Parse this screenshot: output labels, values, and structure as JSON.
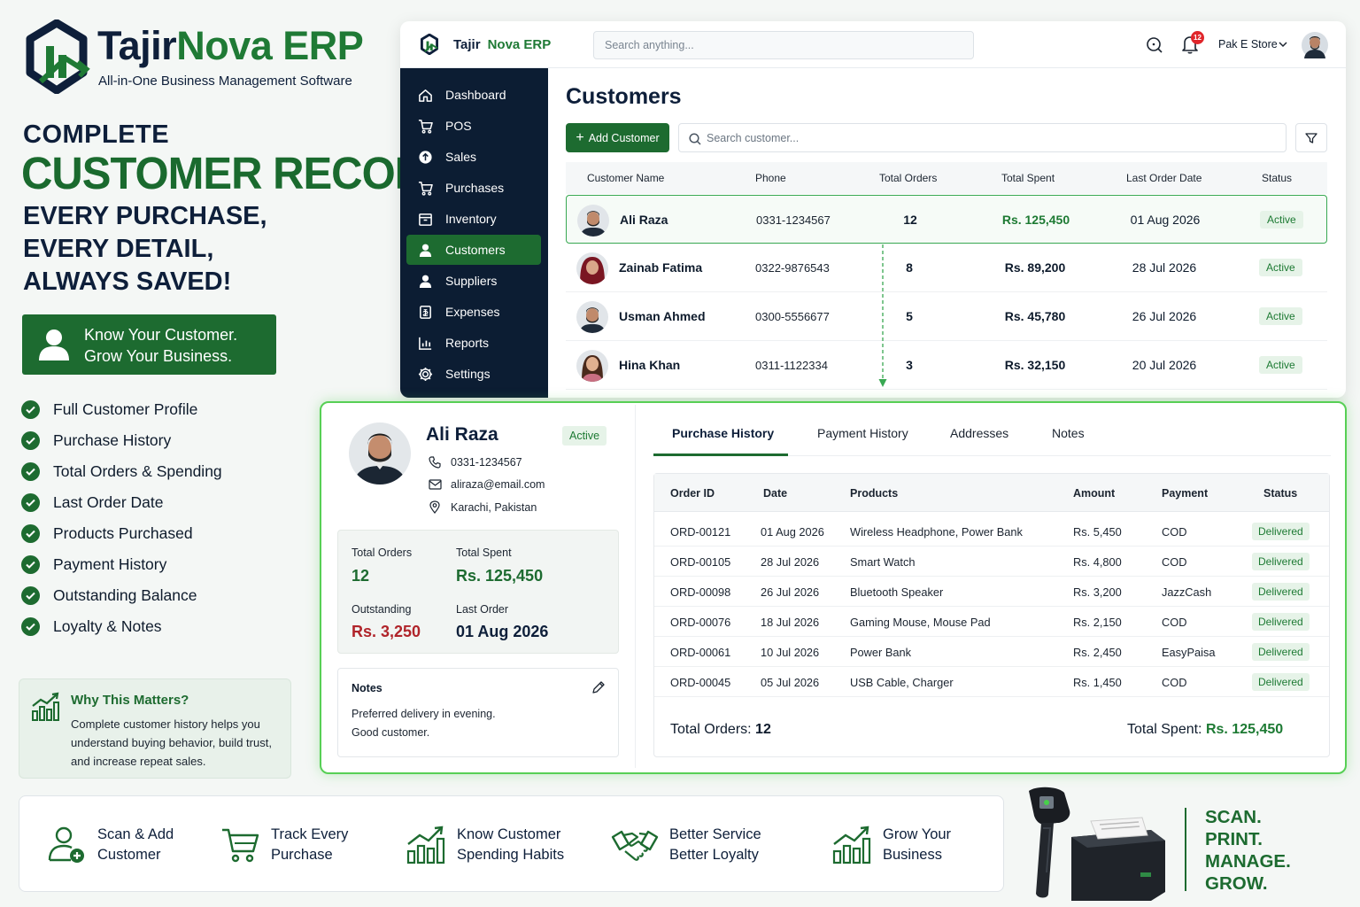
{
  "logo": {
    "name_part1": "Tajir",
    "name_part2": "Nova ERP",
    "tagline": "All-in-One Business Management Software"
  },
  "headline": {
    "line1": "COMPLETE",
    "line2": "CUSTOMER RECORD",
    "line3": "EVERY PURCHASE,",
    "line4": "EVERY DETAIL,",
    "line5": "ALWAYS SAVED!"
  },
  "banner": {
    "line1": "Know Your Customer.",
    "line2": "Grow Your Business."
  },
  "features": [
    "Full Customer Profile",
    "Purchase History",
    "Total Orders & Spending",
    "Last Order Date",
    "Products Purchased",
    "Payment History",
    "Outstanding Balance",
    "Loyalty & Notes"
  ],
  "why": {
    "title": "Why This Matters?",
    "text": "Complete customer history helps you understand buying behavior, build trust, and increase repeat sales."
  },
  "app": {
    "brand_part1": "Tajir",
    "brand_part2": "Nova ERP",
    "search_placeholder": "Search anything...",
    "notification_count": "12",
    "store_name": "Pak E Store",
    "sidebar": [
      {
        "label": "Dashboard",
        "icon": "home-icon"
      },
      {
        "label": "POS",
        "icon": "cart-icon"
      },
      {
        "label": "Sales",
        "icon": "sales-icon"
      },
      {
        "label": "Purchases",
        "icon": "cart-icon"
      },
      {
        "label": "Inventory",
        "icon": "inventory-icon"
      },
      {
        "label": "Customers",
        "icon": "user-icon",
        "active": true
      },
      {
        "label": "Suppliers",
        "icon": "user-icon"
      },
      {
        "label": "Expenses",
        "icon": "receipt-icon"
      },
      {
        "label": "Reports",
        "icon": "chart-icon"
      },
      {
        "label": "Settings",
        "icon": "gear-icon"
      }
    ],
    "page_title": "Customers",
    "add_button": "Add Customer",
    "customer_search_placeholder": "Search customer...",
    "columns": [
      "Customer Name",
      "Phone",
      "Total Orders",
      "Total Spent",
      "Last Order Date",
      "Status"
    ],
    "customers": [
      {
        "name": "Ali Raza",
        "phone": "0331-1234567",
        "orders": "12",
        "spent": "Rs. 125,450",
        "last": "01 Aug 2026",
        "status": "Active"
      },
      {
        "name": "Zainab Fatima",
        "phone": "0322-9876543",
        "orders": "8",
        "spent": "Rs. 89,200",
        "last": "28 Jul 2026",
        "status": "Active"
      },
      {
        "name": "Usman Ahmed",
        "phone": "0300-5556677",
        "orders": "5",
        "spent": "Rs. 45,780",
        "last": "26 Jul 2026",
        "status": "Active"
      },
      {
        "name": "Hina Khan",
        "phone": "0311-1122334",
        "orders": "3",
        "spent": "Rs. 32,150",
        "last": "20 Jul 2026",
        "status": "Active"
      }
    ]
  },
  "profile": {
    "name": "Ali Raza",
    "status": "Active",
    "phone": "0331-1234567",
    "email": "aliraza@email.com",
    "location": "Karachi, Pakistan",
    "stats": {
      "orders_label": "Total Orders",
      "orders": "12",
      "spent_label": "Total Spent",
      "spent": "Rs. 125,450",
      "outstanding_label": "Outstanding",
      "outstanding": "Rs. 3,250",
      "last_label": "Last Order",
      "last": "01 Aug 2026"
    },
    "notes_title": "Notes",
    "notes_line1": "Preferred delivery in evening.",
    "notes_line2": "Good customer."
  },
  "tabs": [
    "Purchase History",
    "Payment History",
    "Addresses",
    "Notes"
  ],
  "orders": {
    "columns": [
      "Order ID",
      "Date",
      "Products",
      "Amount",
      "Payment",
      "Status"
    ],
    "rows": [
      {
        "id": "ORD-00121",
        "date": "01 Aug 2026",
        "products": "Wireless Headphone, Power Bank",
        "amount": "Rs. 5,450",
        "payment": "COD",
        "status": "Delivered"
      },
      {
        "id": "ORD-00105",
        "date": "28 Jul 2026",
        "products": "Smart Watch",
        "amount": "Rs. 4,800",
        "payment": "COD",
        "status": "Delivered"
      },
      {
        "id": "ORD-00098",
        "date": "26 Jul 2026",
        "products": "Bluetooth Speaker",
        "amount": "Rs. 3,200",
        "payment": "JazzCash",
        "status": "Delivered"
      },
      {
        "id": "ORD-00076",
        "date": "18 Jul 2026",
        "products": "Gaming Mouse, Mouse Pad",
        "amount": "Rs. 2,150",
        "payment": "COD",
        "status": "Delivered"
      },
      {
        "id": "ORD-00061",
        "date": "10 Jul 2026",
        "products": "Power Bank",
        "amount": "Rs. 2,450",
        "payment": "EasyPaisa",
        "status": "Delivered"
      },
      {
        "id": "ORD-00045",
        "date": "05 Jul 2026",
        "products": "USB Cable, Charger",
        "amount": "Rs. 1,450",
        "payment": "COD",
        "status": "Delivered"
      }
    ],
    "footer_orders_label": "Total Orders:",
    "footer_orders": "12",
    "footer_spent_label": "Total Spent:",
    "footer_spent": "Rs. 125,450"
  },
  "bottom": [
    {
      "line1": "Scan & Add",
      "line2": "Customer",
      "icon": "add-user-icon"
    },
    {
      "line1": "Track Every",
      "line2": "Purchase",
      "icon": "cart-icon"
    },
    {
      "line1": "Know Customer",
      "line2": "Spending Habits",
      "icon": "growth-chart-icon"
    },
    {
      "line1": "Better Service",
      "line2": "Better Loyalty",
      "icon": "handshake-icon"
    },
    {
      "line1": "Grow Your",
      "line2": "Business",
      "icon": "growth-chart-icon"
    }
  ],
  "tagline": [
    "SCAN.",
    "PRINT.",
    "MANAGE.",
    "GROW."
  ],
  "colors": {
    "brand_green": "#1d6b30",
    "navy": "#0c1d33",
    "accent_green": "#57cf55",
    "danger": "#b0242a"
  }
}
